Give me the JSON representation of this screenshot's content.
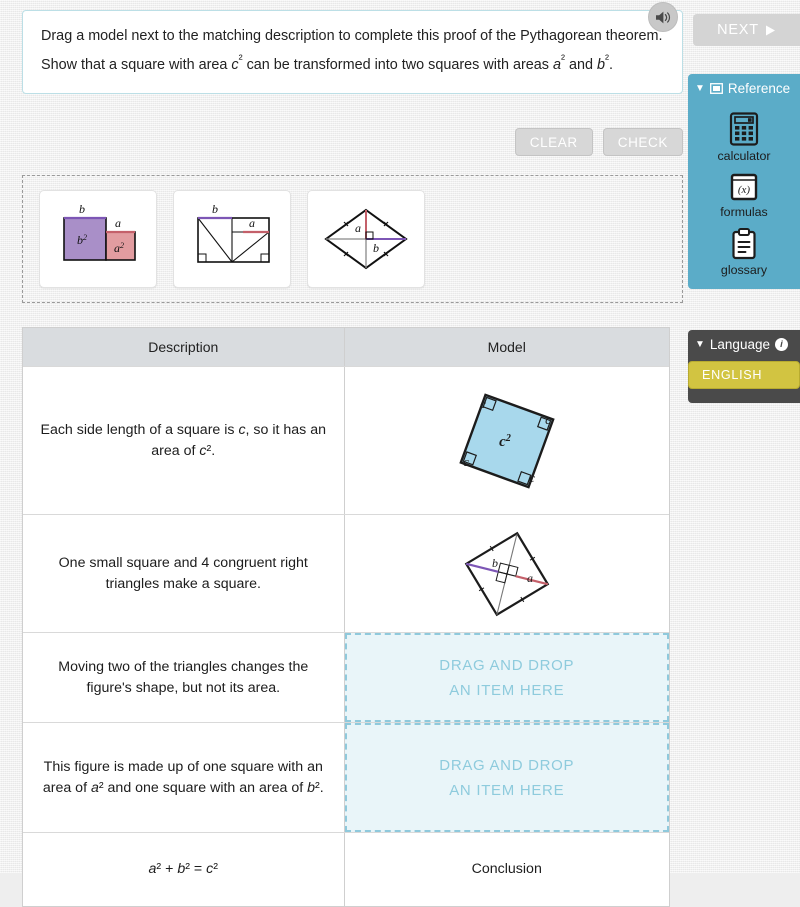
{
  "prompt": {
    "line1_a": "Drag a model next to the matching description to complete this proof of the Pythagorean theorem. Show that a square with area ",
    "line1_b": "c",
    "line1_c": " can be transformed into two squares with areas ",
    "line1_d": "a",
    "line1_e": " and ",
    "line1_f": "b",
    "line1_g": ".",
    "sup": "²"
  },
  "audio": {
    "icon": "speaker-icon"
  },
  "actions": {
    "clear_label": "CLEAR",
    "check_label": "CHECK"
  },
  "tray": {
    "tiles": [
      {
        "id": "model-two-squares",
        "label_b": "b",
        "label_b2": "b",
        "label_a": "a",
        "label_a2": "a",
        "sup": "2"
      },
      {
        "id": "model-rearranged",
        "label_b": "b",
        "label_a": "a"
      },
      {
        "id": "model-rhombus",
        "label_a": "a",
        "label_b": "b"
      }
    ]
  },
  "table": {
    "headers": {
      "description": "Description",
      "model": "Model"
    },
    "rows": [
      {
        "id": "row-square-c",
        "desc_a": "Each side length of a square is ",
        "desc_i1": "c",
        "desc_b": ", so it has an area of ",
        "desc_i2": "c",
        "desc_sup": "²",
        "desc_c": ".",
        "model_type": "square-c2",
        "model_label": "c",
        "model_side": "c"
      },
      {
        "id": "row-small-square-triangles",
        "desc_full": "One small square and 4 congruent right triangles make a square.",
        "model_type": "tilted-square-triangles",
        "label_a": "a",
        "label_b": "b"
      },
      {
        "id": "row-moving-triangles",
        "desc_full": "Moving two of the triangles changes the figure's shape, but not its area.",
        "model_type": "dropzone",
        "dropzone_line1": "DRAG AND DROP",
        "dropzone_line2": "AN ITEM HERE"
      },
      {
        "id": "row-two-squares",
        "desc_a": "This figure is made up of one square with an area of ",
        "desc_i1": "a",
        "desc_b": " and one square with an area of ",
        "desc_i2": "b",
        "desc_sup": "²",
        "desc_c": ".",
        "model_type": "dropzone",
        "dropzone_line1": "DRAG AND DROP",
        "dropzone_line2": "AN ITEM HERE"
      },
      {
        "id": "row-conclusion",
        "desc_eq_a": "a",
        "desc_eq_b": " + ",
        "desc_eq_c": "b",
        "desc_eq_d": " = ",
        "desc_eq_e": "c",
        "desc_sup": "²",
        "model_type": "text",
        "model_label": "Conclusion"
      }
    ]
  },
  "rail": {
    "next_label": "NEXT",
    "next_icon": "play-triangle-icon",
    "reference": {
      "title": "Reference",
      "caret": "▼",
      "items": [
        {
          "label": "calculator",
          "icon": "calculator-icon"
        },
        {
          "label": "formulas",
          "icon": "formulas-icon",
          "glyph": "(x)"
        },
        {
          "label": "glossary",
          "icon": "clipboard-icon"
        }
      ]
    },
    "language": {
      "title": "Language",
      "caret": "▼",
      "info": "i",
      "selected": "ENGLISH"
    }
  },
  "colors": {
    "accent_teal": "#5bacc8",
    "dropzone_bg": "#e9f5f9",
    "dropzone_border": "#8fc9dc",
    "dropzone_text": "#8ecbdd",
    "square_b": "#a98fc8",
    "square_a": "#e29ca0",
    "square_c": "#a8d8ec",
    "language_panel": "#4a4a4a",
    "language_btn": "#d2c441",
    "header_row": "#d9dcdf"
  }
}
